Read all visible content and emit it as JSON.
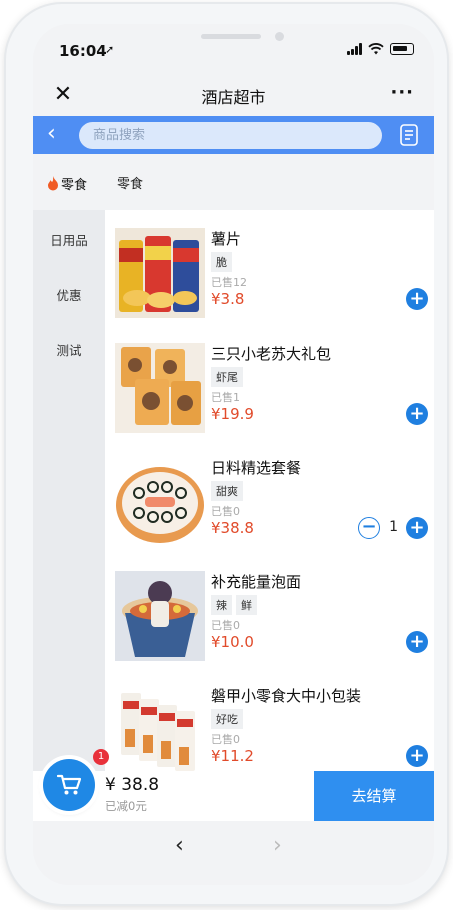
{
  "status_bar": {
    "time": "16:04",
    "location_glyph": "➚"
  },
  "nav": {
    "title": "酒店超市",
    "close_label": "✕",
    "more_label": "···"
  },
  "search": {
    "placeholder": "商品搜索",
    "back_label": "‹"
  },
  "categories": {
    "active": "零食",
    "section_title": "零食",
    "items": [
      {
        "label": "日用品"
      },
      {
        "label": "优惠"
      },
      {
        "label": "测试"
      }
    ]
  },
  "products": [
    {
      "name": "薯片",
      "tags": [
        "脆"
      ],
      "sold": "已售12",
      "price": "¥3.8",
      "qty": null
    },
    {
      "name": "三只小老苏大礼包",
      "tags": [
        "虾尾"
      ],
      "sold": "已售1",
      "price": "¥19.9",
      "qty": null
    },
    {
      "name": "日料精选套餐",
      "tags": [
        "甜爽"
      ],
      "sold": "已售0",
      "price": "¥38.8",
      "qty": "1"
    },
    {
      "name": "补充能量泡面",
      "tags": [
        "辣",
        "鲜"
      ],
      "sold": "已售0",
      "price": "¥10.0",
      "qty": null
    },
    {
      "name": "磐甲小零食大中小包装",
      "tags": [
        "好吃"
      ],
      "sold": "已售0",
      "price": "¥11.2",
      "qty": null
    }
  ],
  "cart": {
    "badge": "1",
    "total": "¥ 38.8",
    "discount": "已减0元",
    "checkout_label": "去结算"
  },
  "browser_nav": {
    "back": "‹",
    "forward": "›"
  },
  "colors": {
    "accent": "#1f7fe0",
    "price": "#e14b2b",
    "header": "#4f8ef3"
  }
}
